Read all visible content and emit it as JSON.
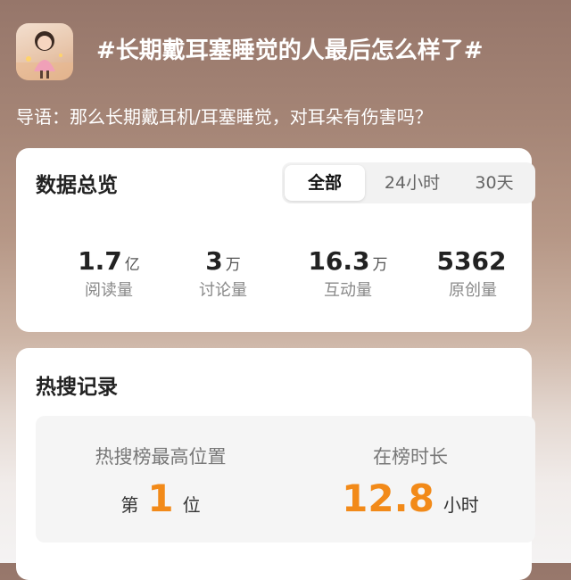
{
  "header": {
    "title": "#长期戴耳塞睡觉的人最后怎么样了#",
    "lead": "导语：那么长期戴耳机/耳塞睡觉，对耳朵有伤害吗？"
  },
  "overview": {
    "title": "数据总览",
    "tabs": [
      {
        "label": "全部",
        "active": true
      },
      {
        "label": "24小时",
        "active": false
      },
      {
        "label": "30天",
        "active": false
      }
    ],
    "stats": [
      {
        "value": "1.7",
        "unit": "亿",
        "label": "阅读量"
      },
      {
        "value": "3",
        "unit": "万",
        "label": "讨论量"
      },
      {
        "value": "16.3",
        "unit": "万",
        "label": "互动量"
      },
      {
        "value": "5362",
        "unit": "",
        "label": "原创量"
      }
    ]
  },
  "hot_search": {
    "title": "热搜记录",
    "highest_rank": {
      "label": "热搜榜最高位置",
      "prefix": "第",
      "value": "1",
      "suffix": "位"
    },
    "duration": {
      "label": "在榜时长",
      "value": "12.8",
      "unit": "小时"
    }
  },
  "colors": {
    "accent": "#f28a19"
  }
}
